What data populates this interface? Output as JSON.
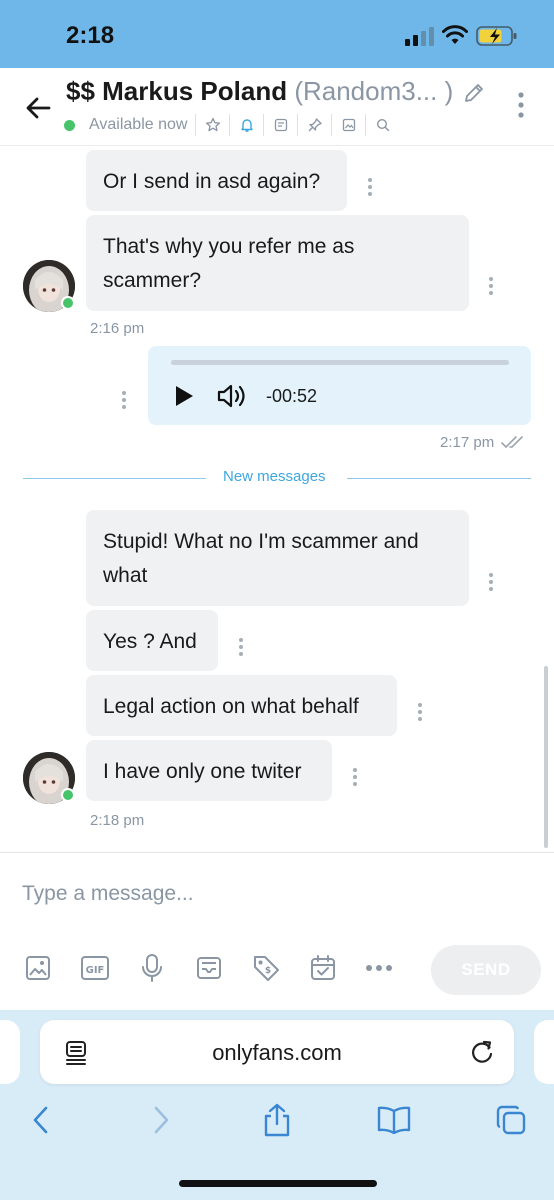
{
  "status_bar": {
    "time": "2:18"
  },
  "header": {
    "name": "$$ Markus Poland",
    "username": "(Random3... )",
    "status": "Available now"
  },
  "messages": [
    {
      "text": "Or I send in asd again?"
    },
    {
      "text": "That's why you refer me as scammer?"
    },
    {
      "time": "2:16 pm"
    },
    {
      "voice_duration": "-00:52",
      "time": "2:17 pm"
    },
    {
      "text": "Stupid! What no I'm scammer and what"
    },
    {
      "text": "Yes ? And"
    },
    {
      "text": "Legal action on what behalf"
    },
    {
      "text": "I have only one twiter"
    },
    {
      "time": "2:18 pm"
    }
  ],
  "divider": {
    "label": "New messages"
  },
  "composer": {
    "placeholder": "Type a message...",
    "send_label": "SEND",
    "tools": [
      "image-icon",
      "gif-icon",
      "microphone-icon",
      "vault-icon",
      "price-tag-icon",
      "calendar-icon",
      "more-icon"
    ]
  },
  "browser": {
    "url": "onlyfans.com"
  },
  "colors": {
    "status_bar": "#6fb7e8",
    "accent": "#3ea6e0",
    "online": "#47c46a",
    "incoming_bubble": "#f0f1f3",
    "outgoing_bubble": "#e3f2fb",
    "muted_text": "#8a96a3"
  }
}
